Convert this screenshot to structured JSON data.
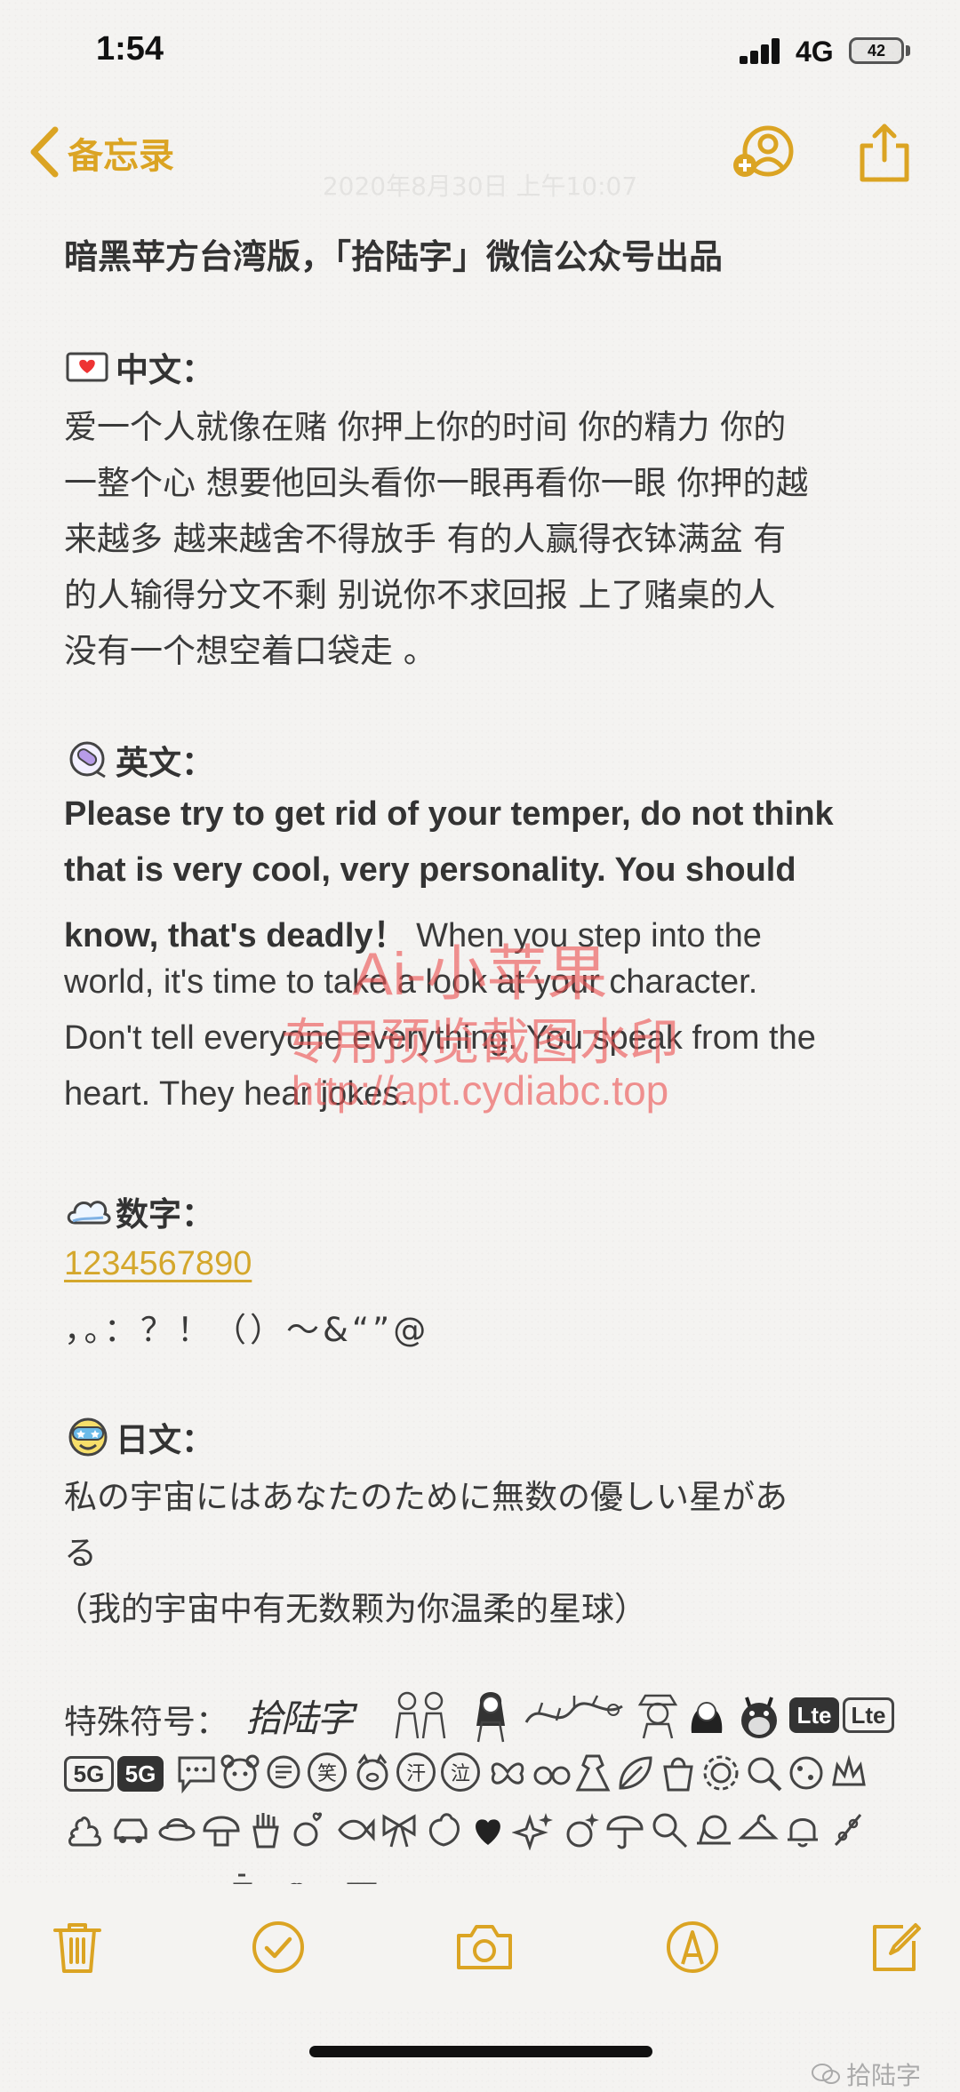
{
  "status_bar": {
    "time": "1:54",
    "network": "4G",
    "battery": "42"
  },
  "nav": {
    "back_label": "备忘录"
  },
  "note": {
    "date": "2020年8月30日 上午10:07",
    "title": "暗黑苹方台湾版，「拾陆字」微信公众号出品",
    "chinese_label": "中文：",
    "chinese_lines": [
      "爱一个人就像在赌 你押上你的时间 你的精力 你的",
      "一整个心 想要他回头看你一眼再看你一眼 你押的越",
      "来越多 越来越舍不得放手 有的人赢得衣钵满盆 有",
      "的人输得分文不剩 别说你不求回报 上了赌桌的人",
      "没有一个想空着口袋走 。"
    ],
    "english_label": "英文：",
    "english_bold_lines": [
      "Please try to get rid of your temper, do not think",
      "that is very cool, very personality. You should"
    ],
    "english_bold_tail": "know, that's deadly！",
    "english_regular_tail": " When you step into the",
    "english_regular_lines": [
      "world, it's time to take a look at your character.",
      "Don't tell everyone everything. You speak from the",
      "heart. They hear jokes."
    ],
    "digits_label": "数字：",
    "digits": "1234567890",
    "punctuation": "，。：？！（）～&“”@",
    "japanese_label": "日文：",
    "japanese_lines": [
      "私の宇宙にはあなたのために無数の優しい星があ",
      "る"
    ],
    "japanese_translation": "（我的宇宙中有无数颗为你温柔的星球）",
    "special_label": "特殊符号：",
    "special_signature": "拾陆字",
    "special_tags": [
      "Lte",
      "Lte",
      "5G",
      "5G"
    ],
    "special_chars": [
      "笑",
      "汗",
      "泣"
    ]
  },
  "watermark": {
    "line1": "Ai-小苹果",
    "line2": "专用预览截图水印",
    "line3": "http://apt.cydiabc.top"
  },
  "footer_mark": "拾陆字",
  "colors": {
    "accent": "#dba423",
    "text": "#3a3a3a",
    "watermark": "#eb5050"
  }
}
